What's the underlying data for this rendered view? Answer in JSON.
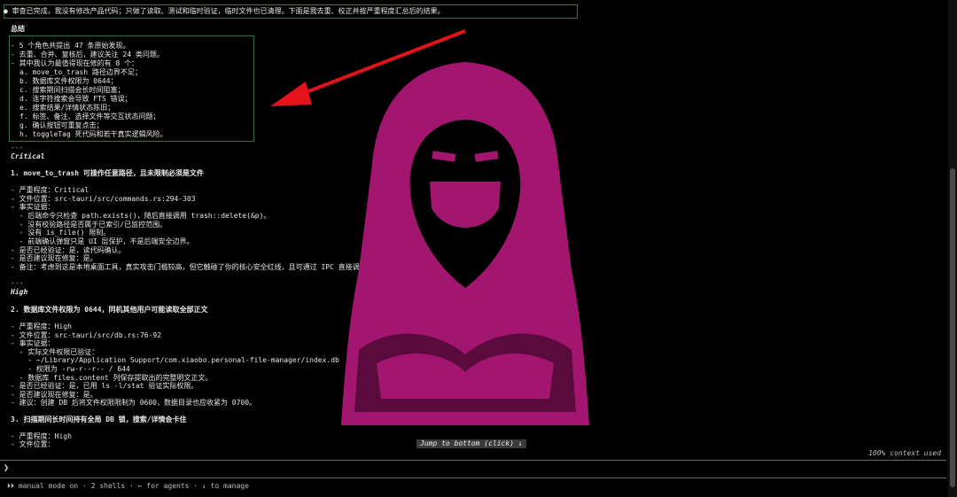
{
  "intro": "审查已完成，我没有修改产品代码；只做了读取、测试和临时验证，临时文件也已清理。下面是我去重、校正并按严重程度汇总后的结果。",
  "summary": {
    "heading": "总结",
    "line1": "- 5 个角色共提出 47 条原始发现。",
    "line2": "- 去重、合并、复核后，建议关注 24 类问题。",
    "line3": "- 其中我认为最值得现在修的有 8 个：",
    "items": [
      "a. move_to_trash 路径边界不足；",
      "b. 数据库文件权限为 0644；",
      "c. 搜索期间扫描会长时间阻塞；",
      "d. 连字符搜索会导致 FTS 错误；",
      "e. 搜索结果/详情状态陈旧；",
      "f. 标签、备注、选择文件等交互状态问题；",
      "g. 确认按钮可重复点击；",
      "h. toggleTag 死代码和若干真实逻辑风险。"
    ]
  },
  "sep1": "---",
  "critical": {
    "label": "Critical",
    "title": "1. move_to_trash 可操作任意路径，且未限制必须是文件",
    "severity": "- 严重程度：Critical",
    "location": "- 文件位置：src-tauri/src/commands.rs:294-303",
    "evidence": "- 事实证据：",
    "e1": "  - 后端命令只检查 path.exists()，随后直接调用 trash::delete(&p)。",
    "e2": "  - 没有校验路径是否属于已索引/已监控范围。",
    "e3": "  - 没有 is_file() 限制。",
    "e4": "  - 前端确认弹窗只是 UI 层保护，不是后端安全边界。",
    "verified": "- 是否已经验证：是，读代码确认。",
    "fix": "- 是否建议现在修复：是。",
    "note": "- 备注：考虑到这是本地桌面工具，真实攻击门槛较高，但它触碰了你的核心安全红线，且可通过 IPC 直接调用，建议优先修。"
  },
  "sep2": "---",
  "high": {
    "label": "High",
    "title": "2. 数据库文件权限为 0644，同机其他用户可能读取全部正文",
    "severity": "- 严重程度：High",
    "location": "- 文件位置：src-tauri/src/db.rs:76-92",
    "evidence": "- 事实证据：",
    "e1": "  - 实际文件权限已验证：",
    "e2": "    - ~/Library/Application Support/com.xiaobo.personal-file-manager/index.db",
    "e3": "    - 权限为 -rw-r--r-- / 644",
    "e4": "  - 数据库 files.content 列保存提取出的完整明文正文。",
    "verified": "- 是否已经验证：是，已用 ls -l/stat 验证实际权限。",
    "fix": "- 是否建议现在修复：是。",
    "advice": "- 建议：创建 DB 后将文件权限限制为 0600，数据目录也应收紧为 0700。"
  },
  "third": {
    "title": "3. 扫描期间长时间持有全局 DB 锁，搜索/详情会卡住",
    "severity": "- 严重程度：High",
    "location": "- 文件位置："
  },
  "jump_label": "Jump to bottom (click) ↓",
  "context_label": "100% context used",
  "prompt_symbol": "❯",
  "status_bar": "⏵⏵ manual mode on · 2 shells · ← for agents · ↓ to manage",
  "colors": {
    "hood": "#a3166f",
    "hood_dark": "#5a0a3c",
    "arrow": "#e3121b",
    "box_border": "#3a6e4a"
  }
}
